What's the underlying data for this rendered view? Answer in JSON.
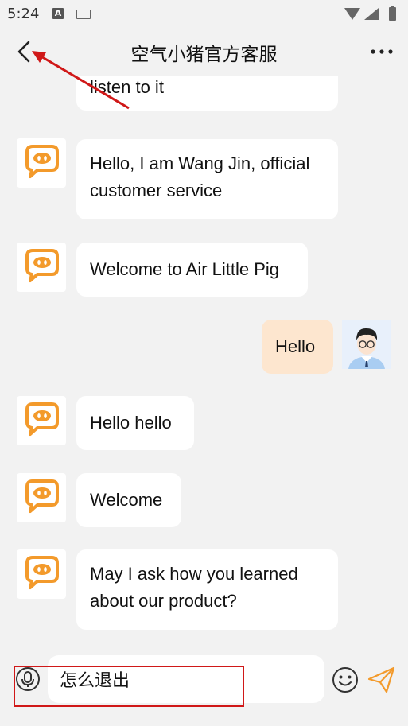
{
  "status_bar": {
    "time": "5:24",
    "a_badge": "A"
  },
  "header": {
    "title": "空气小猪官方客服"
  },
  "messages": [
    {
      "from": "bot",
      "text": "listen to it"
    },
    {
      "from": "bot",
      "text": "Hello, I am Wang Jin, official customer service"
    },
    {
      "from": "bot",
      "text": "Welcome to Air Little Pig"
    },
    {
      "from": "user",
      "text": "Hello"
    },
    {
      "from": "bot",
      "text": "Hello hello"
    },
    {
      "from": "bot",
      "text": "Welcome"
    },
    {
      "from": "bot",
      "text": "May I ask how you learned about our product?"
    }
  ],
  "input": {
    "value": "怎么退出"
  },
  "colors": {
    "accent": "#f39a2b",
    "user_bubble": "#fde6cf",
    "annotation": "#d01818"
  },
  "icons": [
    "back-icon",
    "more-icon",
    "bot-avatar-icon",
    "user-avatar-icon",
    "microphone-icon",
    "emoji-icon",
    "send-icon"
  ]
}
